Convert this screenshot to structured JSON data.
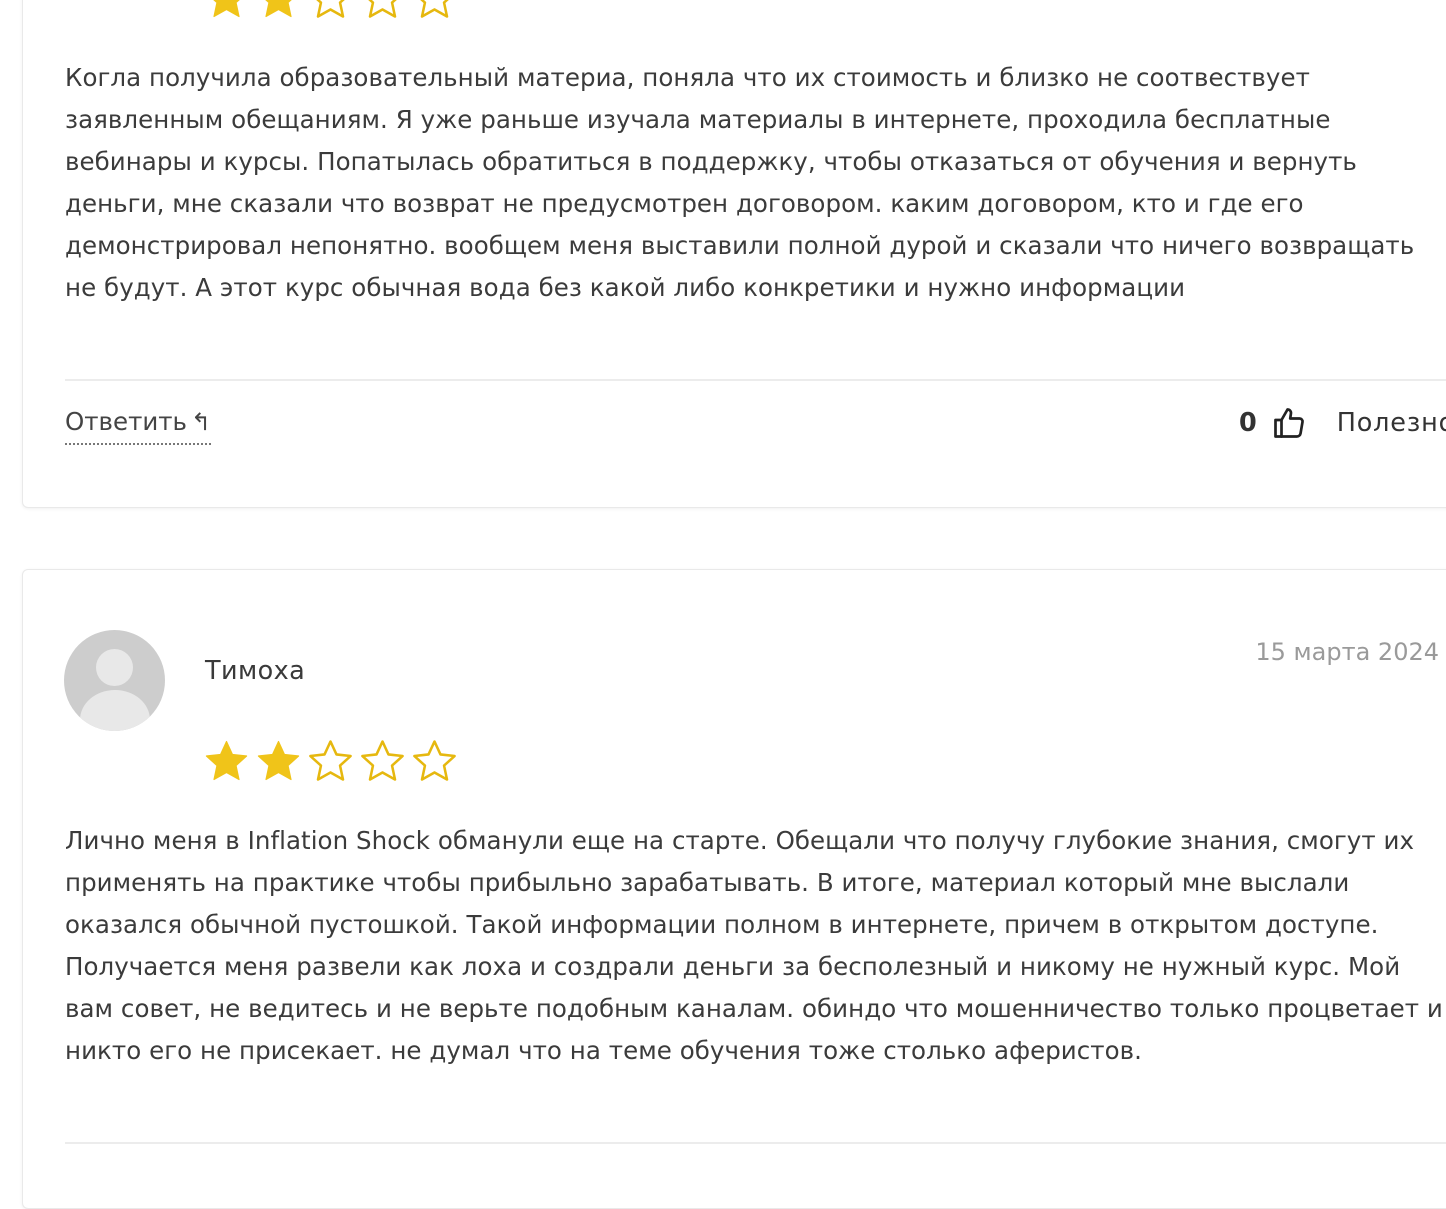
{
  "colors": {
    "star_filled": "#f0c419",
    "star_outline": "#e6b80f",
    "text": "#3b3b3b",
    "muted": "#9a9a9a",
    "divider": "#ececec"
  },
  "reviews": [
    {
      "rating": 2,
      "max_rating": 5,
      "text": "Когла получила образовательный материа, поняла что их стоимость и близко не соотвествует заявленным обещаниям. Я уже раньше изучала материалы в интернете, проходила бесплатные вебинары и курсы. Попатылась обратиться в поддержку, чтобы отказаться от обучения и вернуть деньги, мне сказали что возврат не предусмотрен договором. каким договором, кто и где его демонстрировал непонятно. вообщем меня выставили полной дурой и сказали что ничего возвращать не будут. А этот курс обычная вода без какой либо конкретики и нужно информации",
      "reply_label": "Ответить",
      "reply_icon": "reply-arrow-icon",
      "helpful_count": "0",
      "helpful_icon": "thumbs-up-icon",
      "helpful_label": "Полезно"
    },
    {
      "author": "Тимоха",
      "date": "15 марта 2024",
      "avatar_icon": "user-avatar-placeholder",
      "rating": 2,
      "max_rating": 5,
      "text": "Лично меня в Inflation Shock обманули еще на старте. Обещали что получу глубокие знания, смогут их применять на практике чтобы прибыльно зарабатывать. В итоге, материал который мне выслали оказался обычной пустошкой. Такой информации полном в интернете, причем в открытом доступе. Получается меня развели как лоха и создрали деньги за бесполезный и никому не нужный курс. Мой вам совет, не ведитесь и не верьте подобным каналам. обиндо что мошенничество только процветает и никто его не присекает. не думал что на теме обучения тоже столько аферистов."
    }
  ]
}
